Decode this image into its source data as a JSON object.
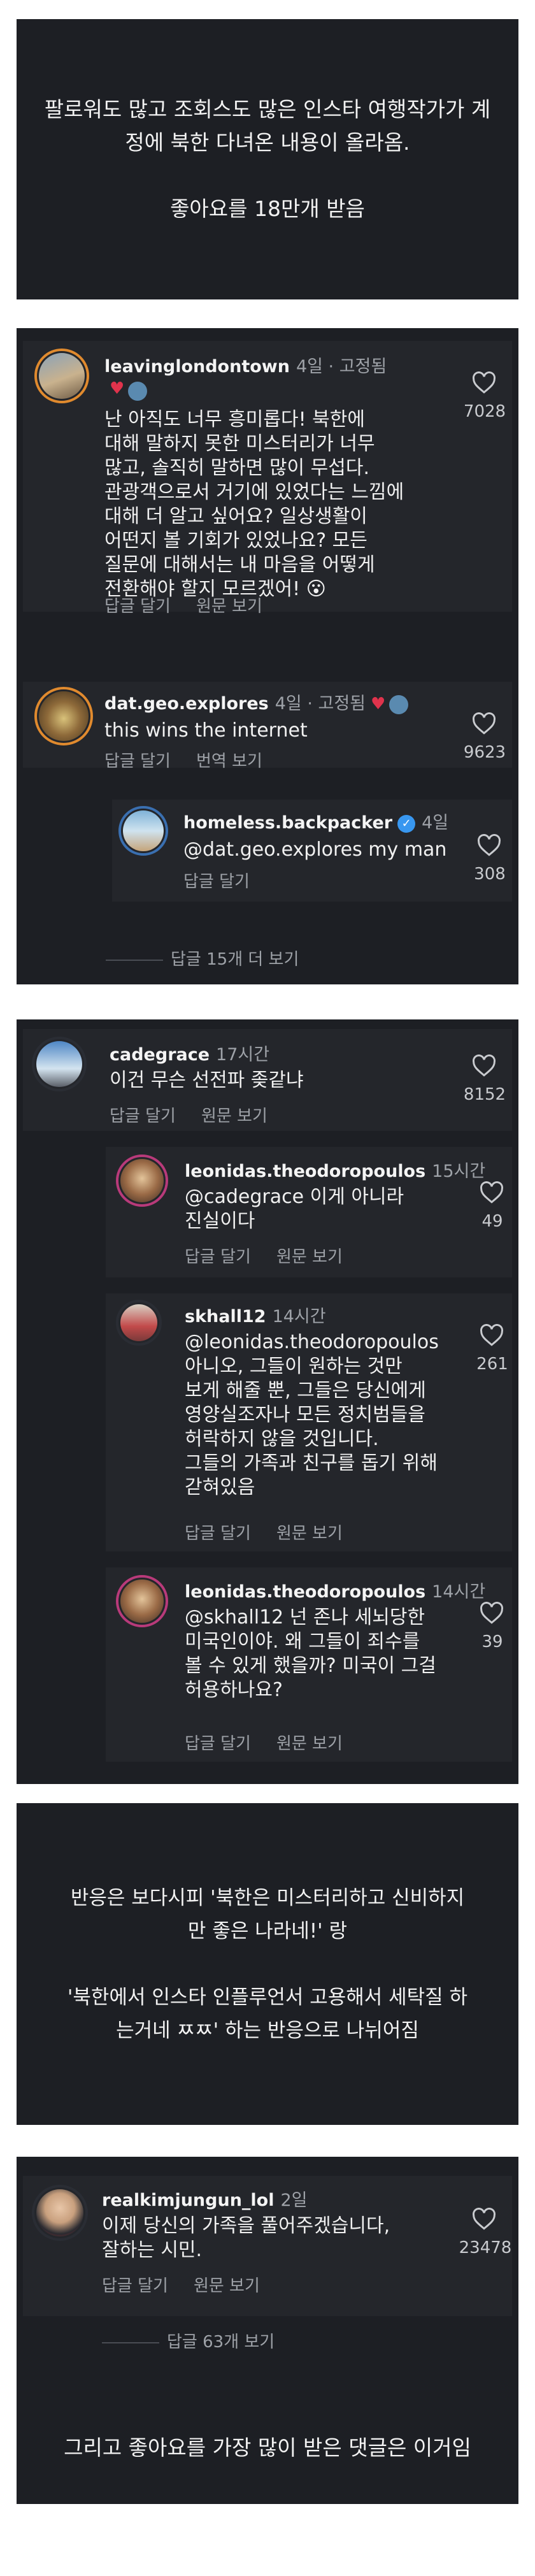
{
  "caption1": {
    "line1": "팔로워도 많고 조회스도 많은 인스타 여행작가가 계",
    "line2": "정에 북한 다녀온 내용이 올라옴.",
    "line3": "좋아요를 18만개 받음"
  },
  "ui": {
    "reply": "답글 달기",
    "see_original": "원문 보기",
    "see_translation": "번역 보기"
  },
  "thread1": {
    "main": {
      "username": "leavinglondontown",
      "meta": "4일 · 고정됨",
      "likes": "7028",
      "lines": [
        "난 아직도 너무 흥미롭다! 북한에",
        "대해 말하지 못한 미스터리가 너무",
        "많고, 솔직히 말하면 많이 무섭다.",
        "관광객으로서 거기에 있었다는 느낌에",
        "대해 더 알고 싶어요? 일상생활이",
        "어떤지 볼 기회가 있었나요? 모든",
        "질문에 대해서는 내 마음을 어떻게",
        "전환해야 할지 모르겠어! 😮"
      ]
    },
    "second": {
      "username": "dat.geo.explores",
      "meta": "4일 · 고정됨",
      "likes": "9623",
      "text": "this wins the internet"
    },
    "reply": {
      "username": "homeless.backpacker",
      "meta": "4일",
      "likes": "308",
      "text1": "@dat.geo.explores my man"
    },
    "more_replies": "답글 15개 더 보기"
  },
  "thread2": {
    "main": {
      "username": "cadegrace",
      "meta": "17시간",
      "likes": "8152",
      "text": "이건 무슨 선전파 좆같냐"
    },
    "reply1": {
      "username": "leonidas.theodoropoulos",
      "meta": "15시간",
      "likes": "49",
      "lines": [
        "@cadegrace 이게 아니라",
        "진실이다"
      ]
    },
    "reply2": {
      "username": "skhall12",
      "meta": "14시간",
      "likes": "261",
      "lines": [
        "@leonidas.theodoropoulos",
        "아니오, 그들이 원하는 것만",
        "보게 해줄 뿐, 그들은 당신에게",
        "영양실조자나 모든 정치범들을",
        "허락하지 않을 것입니다.",
        "그들의 가족과 친구를 돕기 위해",
        "갇혀있음"
      ]
    },
    "reply3": {
      "username": "leonidas.theodoropoulos",
      "meta": "14시간",
      "likes": "39",
      "lines": [
        "@skhall12 넌 존나 세뇌당한",
        "미국인이야. 왜 그들이 죄수를",
        "볼 수 있게 했을까? 미국이 그걸",
        "허용하나요?"
      ]
    }
  },
  "caption2": {
    "line1": "반응은 보다시피 '북한은 미스터리하고 신비하지",
    "line2": "만 좋은 나라네!' 랑",
    "line3": "'북한에서 인스타 인플루언서 고용해서 세탁질 하",
    "line4": "는거네 ㅉㅉ' 하는 반응으로 나뉘어짐"
  },
  "thread3": {
    "main": {
      "username": "realkimjungun_lol",
      "meta": "2일",
      "likes": "23478",
      "lines": [
        "이제 당신의 가족을 풀어주겠습니다,",
        "잘하는 시민."
      ]
    },
    "more_replies": "답글 63개 보기",
    "caption": "그리고 좋아요를 가장 많이 받은 댓글은 이거임"
  },
  "colors": {
    "panel": "#1d1f24",
    "comment_bg": "#24262b",
    "muted": "#9ea2a8",
    "verified": "#3897f0",
    "heart_red": "#e0334c"
  }
}
